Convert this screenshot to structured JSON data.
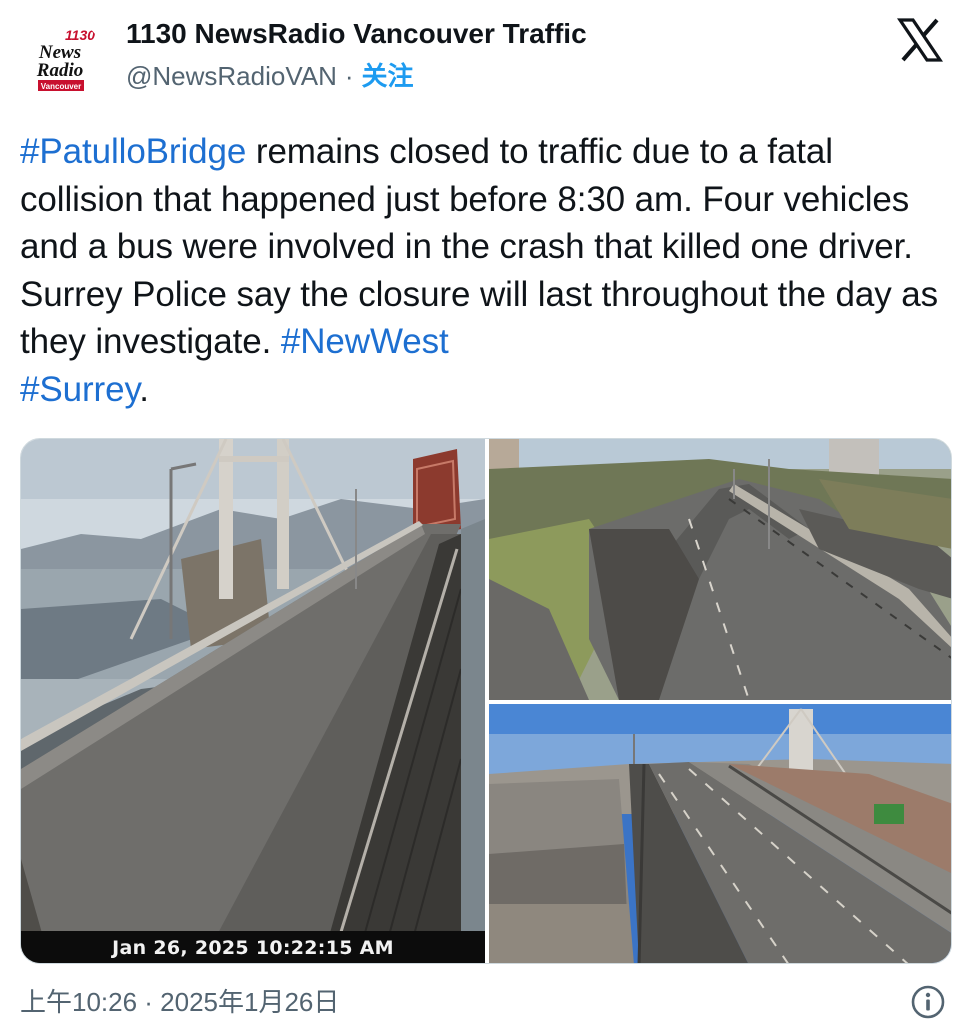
{
  "author": {
    "display_name": "1130 NewsRadio Vancouver Traffic",
    "handle": "@NewsRadioVAN",
    "separator": "·",
    "follow_label": "关注",
    "avatar_logo": {
      "line1": "1130",
      "line2": "News",
      "line3": "Radio",
      "line4": "Vancouver"
    }
  },
  "platform_icon": "x-logo-icon",
  "tweet": {
    "hashtag_patullo": "#PatulloBridge",
    "body": " remains closed to traffic due to a fatal collision that happened just before 8:30 am. Four vehicles and a bus were involved in the crash that killed one driver. Surrey Police say the closure will last throughout the day as they investigate.  ",
    "hashtag_newwest": "#NewWest",
    "hashtag_surrey": "#Surrey",
    "ending": "."
  },
  "media": {
    "camera_timestamp": "Jan 26, 2025 10:22:15 AM"
  },
  "footer": {
    "timestamp": "上午10:26 · 2025年1月26日",
    "info_icon": "info-icon"
  },
  "colors": {
    "link": "#1d6fd1",
    "follow": "#1d9bf0",
    "text": "#0f1419",
    "secondary": "#536471",
    "logo_red": "#c8102e"
  }
}
